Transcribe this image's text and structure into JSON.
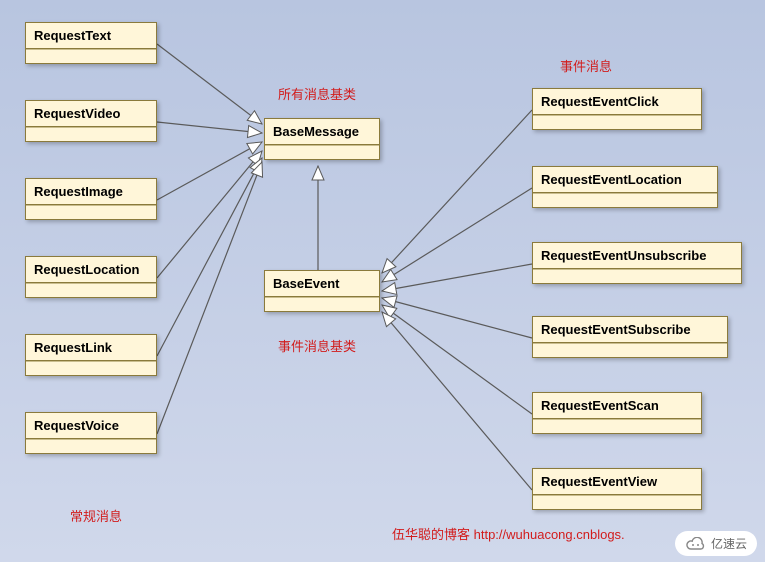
{
  "diagram": {
    "annotations": {
      "normal_msg": "常规消息",
      "base_msg": "所有消息基类",
      "event_base": "事件消息基类",
      "event_msg": "事件消息",
      "credit": "伍华聪的博客 http://wuhuacong.cnblogs."
    },
    "classes": {
      "RequestText": "RequestText",
      "RequestVideo": "RequestVideo",
      "RequestImage": "RequestImage",
      "RequestLocation": "RequestLocation",
      "RequestLink": "RequestLink",
      "RequestVoice": "RequestVoice",
      "BaseMessage": "BaseMessage",
      "BaseEvent": "BaseEvent",
      "RequestEventClick": "RequestEventClick",
      "RequestEventLocation": "RequestEventLocation",
      "RequestEventUnsubscribe": "RequestEventUnsubscribe",
      "RequestEventSubscribe": "RequestEventSubscribe",
      "RequestEventScan": "RequestEventScan",
      "RequestEventView": "RequestEventView"
    },
    "watermark": "亿速云"
  },
  "chart_data": {
    "type": "diagram",
    "kind": "uml-class-inheritance",
    "title": "WeChat message class hierarchy",
    "nodes": [
      {
        "id": "BaseMessage",
        "label": "BaseMessage",
        "note": "所有消息基类"
      },
      {
        "id": "BaseEvent",
        "label": "BaseEvent",
        "note": "事件消息基类"
      },
      {
        "id": "RequestText",
        "label": "RequestText",
        "group": "常规消息"
      },
      {
        "id": "RequestVideo",
        "label": "RequestVideo",
        "group": "常规消息"
      },
      {
        "id": "RequestImage",
        "label": "RequestImage",
        "group": "常规消息"
      },
      {
        "id": "RequestLocation",
        "label": "RequestLocation",
        "group": "常规消息"
      },
      {
        "id": "RequestLink",
        "label": "RequestLink",
        "group": "常规消息"
      },
      {
        "id": "RequestVoice",
        "label": "RequestVoice",
        "group": "常规消息"
      },
      {
        "id": "RequestEventClick",
        "label": "RequestEventClick",
        "group": "事件消息"
      },
      {
        "id": "RequestEventLocation",
        "label": "RequestEventLocation",
        "group": "事件消息"
      },
      {
        "id": "RequestEventUnsubscribe",
        "label": "RequestEventUnsubscribe",
        "group": "事件消息"
      },
      {
        "id": "RequestEventSubscribe",
        "label": "RequestEventSubscribe",
        "group": "事件消息"
      },
      {
        "id": "RequestEventScan",
        "label": "RequestEventScan",
        "group": "事件消息"
      },
      {
        "id": "RequestEventView",
        "label": "RequestEventView",
        "group": "事件消息"
      }
    ],
    "edges": [
      {
        "from": "RequestText",
        "to": "BaseMessage",
        "rel": "generalization"
      },
      {
        "from": "RequestVideo",
        "to": "BaseMessage",
        "rel": "generalization"
      },
      {
        "from": "RequestImage",
        "to": "BaseMessage",
        "rel": "generalization"
      },
      {
        "from": "RequestLocation",
        "to": "BaseMessage",
        "rel": "generalization"
      },
      {
        "from": "RequestLink",
        "to": "BaseMessage",
        "rel": "generalization"
      },
      {
        "from": "RequestVoice",
        "to": "BaseMessage",
        "rel": "generalization"
      },
      {
        "from": "BaseEvent",
        "to": "BaseMessage",
        "rel": "generalization"
      },
      {
        "from": "RequestEventClick",
        "to": "BaseEvent",
        "rel": "generalization"
      },
      {
        "from": "RequestEventLocation",
        "to": "BaseEvent",
        "rel": "generalization"
      },
      {
        "from": "RequestEventUnsubscribe",
        "to": "BaseEvent",
        "rel": "generalization"
      },
      {
        "from": "RequestEventSubscribe",
        "to": "BaseEvent",
        "rel": "generalization"
      },
      {
        "from": "RequestEventScan",
        "to": "BaseEvent",
        "rel": "generalization"
      },
      {
        "from": "RequestEventView",
        "to": "BaseEvent",
        "rel": "generalization"
      }
    ]
  }
}
